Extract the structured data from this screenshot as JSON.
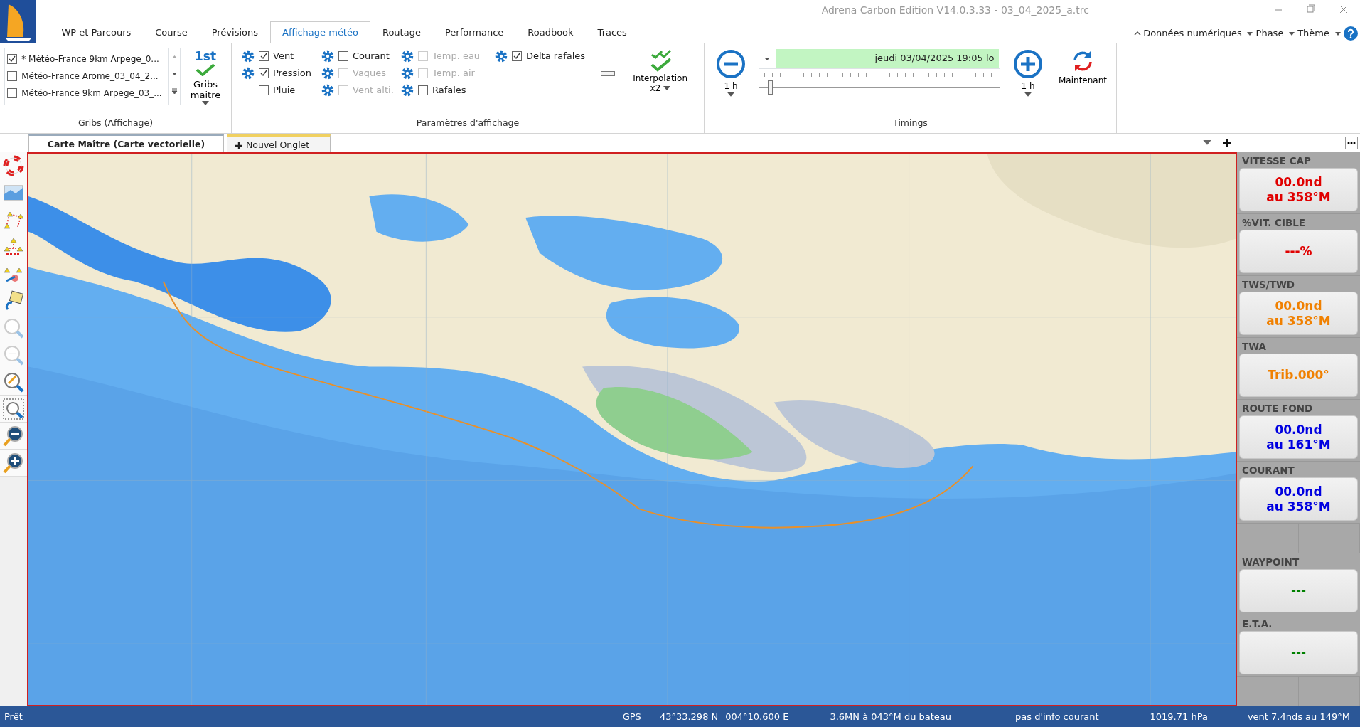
{
  "window": {
    "title": "Adrena Carbon Edition V14.0.3.33 - 03_04_2025_a.trc"
  },
  "ribbon_tabs": [
    {
      "label": "WP et Parcours",
      "selected": false
    },
    {
      "label": "Course",
      "selected": false
    },
    {
      "label": "Prévisions",
      "selected": false
    },
    {
      "label": "Affichage météo",
      "selected": true
    },
    {
      "label": "Routage",
      "selected": false
    },
    {
      "label": "Performance",
      "selected": false
    },
    {
      "label": "Roadbook",
      "selected": false
    },
    {
      "label": "Traces",
      "selected": false
    }
  ],
  "ribbon_menus": [
    {
      "label": "Données numériques",
      "kind": "up"
    },
    {
      "label": "Phase",
      "kind": "down"
    },
    {
      "label": "Thème",
      "kind": "down"
    }
  ],
  "gribs": {
    "items": [
      {
        "label": "* Météo-France 9km Arpege_0...",
        "checked": true
      },
      {
        "label": "Météo-France Arome_03_04_2...",
        "checked": false
      },
      {
        "label": "Météo-France 9km Arpege_03_...",
        "checked": false
      }
    ],
    "master": {
      "badge": "1st",
      "label": "Gribs maitre"
    },
    "group_label": "Gribs (Affichage)"
  },
  "display": {
    "columns": [
      [
        {
          "label": "Vent",
          "checked": true,
          "disabled": false,
          "gear": true
        },
        {
          "label": "Pression",
          "checked": true,
          "disabled": false,
          "gear": true
        },
        {
          "label": "Pluie",
          "checked": false,
          "disabled": false,
          "gear": false
        }
      ],
      [
        {
          "label": "Courant",
          "checked": false,
          "disabled": false,
          "gear": true
        },
        {
          "label": "Vagues",
          "checked": false,
          "disabled": true,
          "gear": true
        },
        {
          "label": "Vent alti.",
          "checked": false,
          "disabled": true,
          "gear": true
        }
      ],
      [
        {
          "label": "Temp. eau",
          "checked": false,
          "disabled": true,
          "gear": true
        },
        {
          "label": "Temp. air",
          "checked": false,
          "disabled": true,
          "gear": true
        },
        {
          "label": "Rafales",
          "checked": false,
          "disabled": false,
          "gear": true
        }
      ],
      [
        {
          "label": "Delta rafales",
          "checked": true,
          "disabled": false,
          "gear": true
        }
      ]
    ],
    "level": 0.6,
    "interpolation": {
      "label": "Interpolation",
      "sub": "x2"
    },
    "group_label": "Paramètres d'affichage"
  },
  "timings": {
    "minus": "1 h",
    "date": "jeudi 03/04/2025 19:05 lo",
    "level": 0.04,
    "plus": "1 h",
    "now": "Maintenant",
    "group_label": "Timings"
  },
  "doc_tabs": [
    {
      "label": "Carte Maître (Carte vectorielle)",
      "selected": true
    },
    {
      "label": "Nouvel Onglet",
      "selected": false
    }
  ],
  "instruments": [
    {
      "kind": "value",
      "title": "VITESSE CAP",
      "lines": [
        "00.0nd",
        "au 358°M"
      ],
      "color": "#e00000"
    },
    {
      "kind": "value",
      "title": "%VIT. CIBLE",
      "lines": [
        "---%"
      ],
      "color": "#e00000"
    },
    {
      "kind": "value",
      "title": "TWS/TWD",
      "lines": [
        "00.0nd",
        "au 358°M"
      ],
      "color": "#f08000"
    },
    {
      "kind": "value",
      "title": "TWA",
      "lines": [
        "Trib.000°"
      ],
      "color": "#f08000"
    },
    {
      "kind": "value",
      "title": "ROUTE FOND",
      "lines": [
        "00.0nd",
        "au 161°M"
      ],
      "color": "#0000e0"
    },
    {
      "kind": "value",
      "title": "COURANT",
      "lines": [
        "00.0nd",
        "au 358°M"
      ],
      "color": "#0000e0"
    },
    {
      "kind": "blank"
    },
    {
      "kind": "value",
      "title": "WAYPOINT",
      "lines": [
        "---"
      ],
      "color": "#008000"
    },
    {
      "kind": "value",
      "title": "E.T.A.",
      "lines": [
        "---"
      ],
      "color": "#008000"
    },
    {
      "kind": "blank"
    }
  ],
  "status_bar": {
    "left": "Prêt",
    "fields": [
      "GPS",
      "43°33.298 N",
      "004°10.600 E",
      "3.6MN à 043°M du bateau",
      "pas d'info courant",
      "1019.71 hPa",
      "vent 7.4nds au 149°M"
    ]
  }
}
